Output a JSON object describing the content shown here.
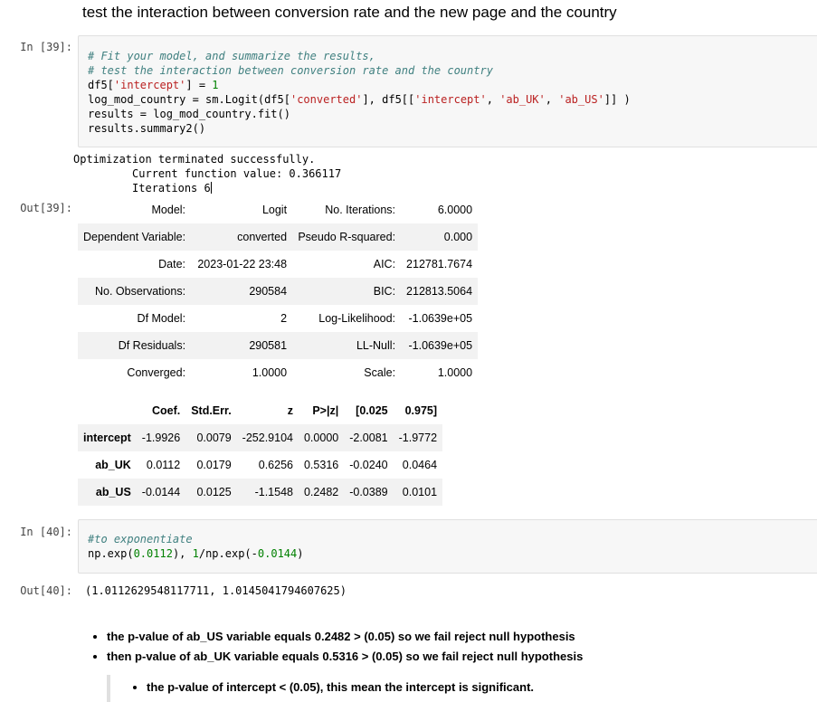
{
  "heading": "test the interaction between conversion rate and the new page and the country",
  "cell39": {
    "in_prompt": "In [39]:",
    "out_prompt": "Out[39]:",
    "code": [
      [
        {
          "t": "cm",
          "v": "# Fit your model, and summarize the results,"
        }
      ],
      [
        {
          "t": "cm",
          "v": "# test the interaction between conversion rate and the country"
        }
      ],
      [
        {
          "t": "op",
          "v": "df5["
        },
        {
          "t": "st",
          "v": "'intercept'"
        },
        {
          "t": "op",
          "v": "] = "
        },
        {
          "t": "nm",
          "v": "1"
        }
      ],
      [
        {
          "t": "op",
          "v": "log_mod_country = sm.Logit(df5["
        },
        {
          "t": "st",
          "v": "'converted'"
        },
        {
          "t": "op",
          "v": "], df5[["
        },
        {
          "t": "st",
          "v": "'intercept'"
        },
        {
          "t": "op",
          "v": ", "
        },
        {
          "t": "st",
          "v": "'ab_UK'"
        },
        {
          "t": "op",
          "v": ", "
        },
        {
          "t": "st",
          "v": "'ab_US'"
        },
        {
          "t": "op",
          "v": "]] )"
        }
      ],
      [
        {
          "t": "op",
          "v": "results = log_mod_country.fit()"
        }
      ],
      [
        {
          "t": "op",
          "v": "results.summary2()"
        }
      ]
    ],
    "stdout": [
      "Optimization terminated successfully.",
      "         Current function value: 0.366117",
      "         Iterations 6"
    ],
    "summary": [
      [
        "Model:",
        "Logit",
        "No. Iterations:",
        "6.0000"
      ],
      [
        "Dependent Variable:",
        "converted",
        "Pseudo R-squared:",
        "0.000"
      ],
      [
        "Date:",
        "2023-01-22 23:48",
        "AIC:",
        "212781.7674"
      ],
      [
        "No. Observations:",
        "290584",
        "BIC:",
        "212813.5064"
      ],
      [
        "Df Model:",
        "2",
        "Log-Likelihood:",
        "-1.0639e+05"
      ],
      [
        "Df Residuals:",
        "290581",
        "LL-Null:",
        "-1.0639e+05"
      ],
      [
        "Converged:",
        "1.0000",
        "Scale:",
        "1.0000"
      ]
    ],
    "coef_headers": [
      "",
      "Coef.",
      "Std.Err.",
      "z",
      "P>|z|",
      "[0.025",
      "0.975]"
    ],
    "coef_rows": [
      [
        "intercept",
        "-1.9926",
        "0.0079",
        "-252.9104",
        "0.0000",
        "-2.0081",
        "-1.9772"
      ],
      [
        "ab_UK",
        "0.0112",
        "0.0179",
        "0.6256",
        "0.5316",
        "-0.0240",
        "0.0464"
      ],
      [
        "ab_US",
        "-0.0144",
        "0.0125",
        "-1.1548",
        "0.2482",
        "-0.0389",
        "0.0101"
      ]
    ]
  },
  "cell40": {
    "in_prompt": "In [40]:",
    "out_prompt": "Out[40]:",
    "code": [
      [
        {
          "t": "cm",
          "v": "#to exponentiate"
        }
      ],
      [
        {
          "t": "op",
          "v": "np.exp("
        },
        {
          "t": "nm",
          "v": "0.0112"
        },
        {
          "t": "op",
          "v": "), "
        },
        {
          "t": "nm",
          "v": "1"
        },
        {
          "t": "op",
          "v": "/np.exp(-"
        },
        {
          "t": "nm",
          "v": "0.0144"
        },
        {
          "t": "op",
          "v": ")"
        }
      ]
    ],
    "output": "(1.0112629548117711, 1.0145041794607625)"
  },
  "markdown": {
    "bullets": [
      "the p-value of ab_US variable equals 0.2482 > (0.05) so we fail reject null hypothesis",
      "then p-value of ab_UK variable equals 0.5316 > (0.05) so we fail reject null hypothesis"
    ],
    "quote_bullet": "the p-value of intercept < (0.05), this mean the intercept is significant."
  }
}
